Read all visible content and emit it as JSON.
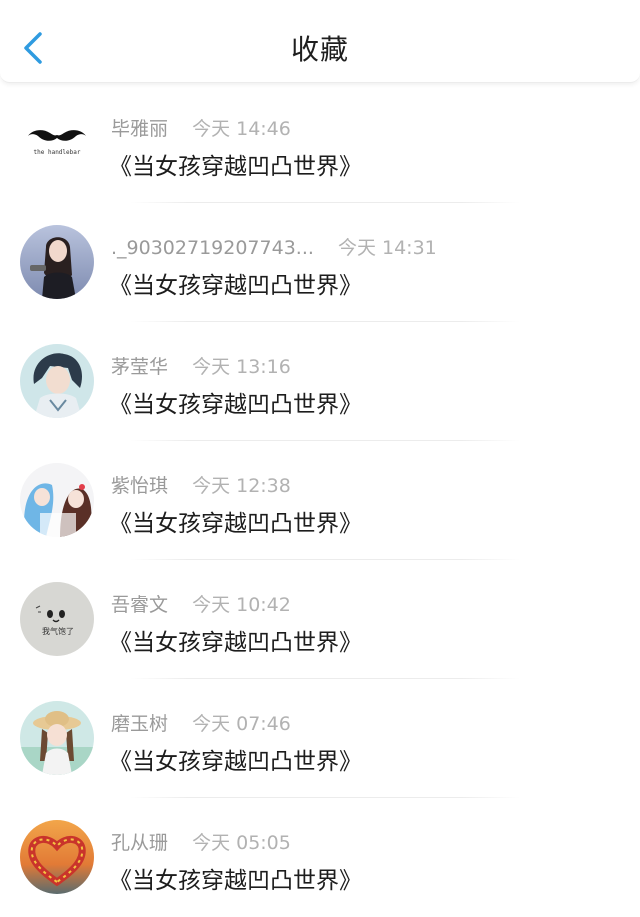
{
  "header": {
    "title": "收藏",
    "back_icon": "chevron-left-icon",
    "accent_color": "#2f9be0"
  },
  "items": [
    {
      "name": "毕雅丽",
      "time": "今天 14:46",
      "title": "《当女孩穿越凹凸世界》",
      "avatar": "mustache-logo-avatar"
    },
    {
      "name": "._90302719207743...",
      "time": "今天 14:31",
      "title": "《当女孩穿越凹凸世界》",
      "avatar": "girl-photo-avatar"
    },
    {
      "name": "茅莹华",
      "time": "今天 13:16",
      "title": "《当女孩穿越凹凸世界》",
      "avatar": "anime-boy-avatar"
    },
    {
      "name": "紫怡琪",
      "time": "今天 12:38",
      "title": "《当女孩穿越凹凸世界》",
      "avatar": "anime-girls-avatar"
    },
    {
      "name": "吾睿文",
      "time": "今天 10:42",
      "title": "《当女孩穿越凹凸世界》",
      "avatar": "doodle-face-avatar"
    },
    {
      "name": "磨玉树",
      "time": "今天 07:46",
      "title": "《当女孩穿越凹凸世界》",
      "avatar": "girl-straw-hat-avatar"
    },
    {
      "name": "孔从珊",
      "time": "今天 05:05",
      "title": "《当女孩穿越凹凸世界》",
      "avatar": "heart-sunset-avatar"
    }
  ]
}
